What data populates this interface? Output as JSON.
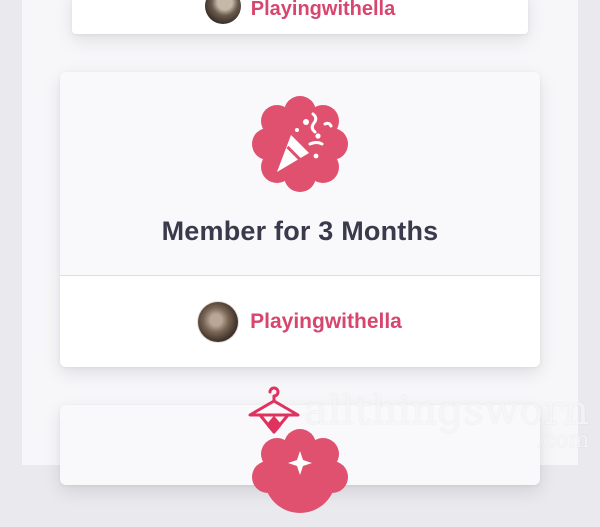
{
  "previous_card": {
    "username": "Playingwithella"
  },
  "badge_card": {
    "icon": "party-popper-icon",
    "title": "Member for 3 Months",
    "username": "Playingwithella"
  },
  "next_card": {
    "icon": "sparkle-badge-icon"
  },
  "watermark": {
    "text": "allthingsworn",
    "domain": ".com"
  },
  "colors": {
    "accent": "#d6466e",
    "badge_fill": "#e0516f",
    "title": "#3a3a4c"
  }
}
